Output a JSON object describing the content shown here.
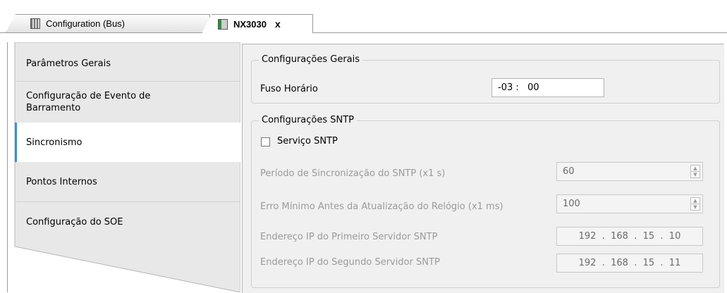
{
  "tabs": [
    {
      "label": "Configuration (Bus)",
      "icon": "device-grid-icon"
    },
    {
      "label": "NX3030",
      "icon": "cpu-module-icon",
      "close": "x"
    }
  ],
  "nav": [
    {
      "label": "Parâmetros Gerais"
    },
    {
      "label": "Configuração de Evento de Barramento"
    },
    {
      "label": "Sincronismo",
      "selected": true
    },
    {
      "label": "Pontos Internos"
    },
    {
      "label": "Configuração do SOE"
    }
  ],
  "general": {
    "title": "Configurações Gerais",
    "timezone_label": "Fuso Horário",
    "timezone_value": "-03 :   00"
  },
  "sntp": {
    "title": "Configurações SNTP",
    "service_label": "Serviço SNTP",
    "service_checked": false,
    "period_label": "Período de Sincronização do SNTP (x1 s)",
    "period_value": "60",
    "min_error_label": "Erro Mínimo Antes da Atualização do Relógio (x1 ms)",
    "min_error_value": "100",
    "ip1_label": "Endereço IP do Primeiro Servidor SNTP",
    "ip1_value": "192  .  168  .  15  .  10",
    "ip2_label": "Endereço IP do Segundo Servidor SNTP",
    "ip2_value": "192  .  168  .  15  .  11"
  },
  "colors": {
    "selected_accent": "#3b8fd4",
    "panel_bg": "#f0f0f0",
    "nav_bg": "#e8e8e8"
  }
}
